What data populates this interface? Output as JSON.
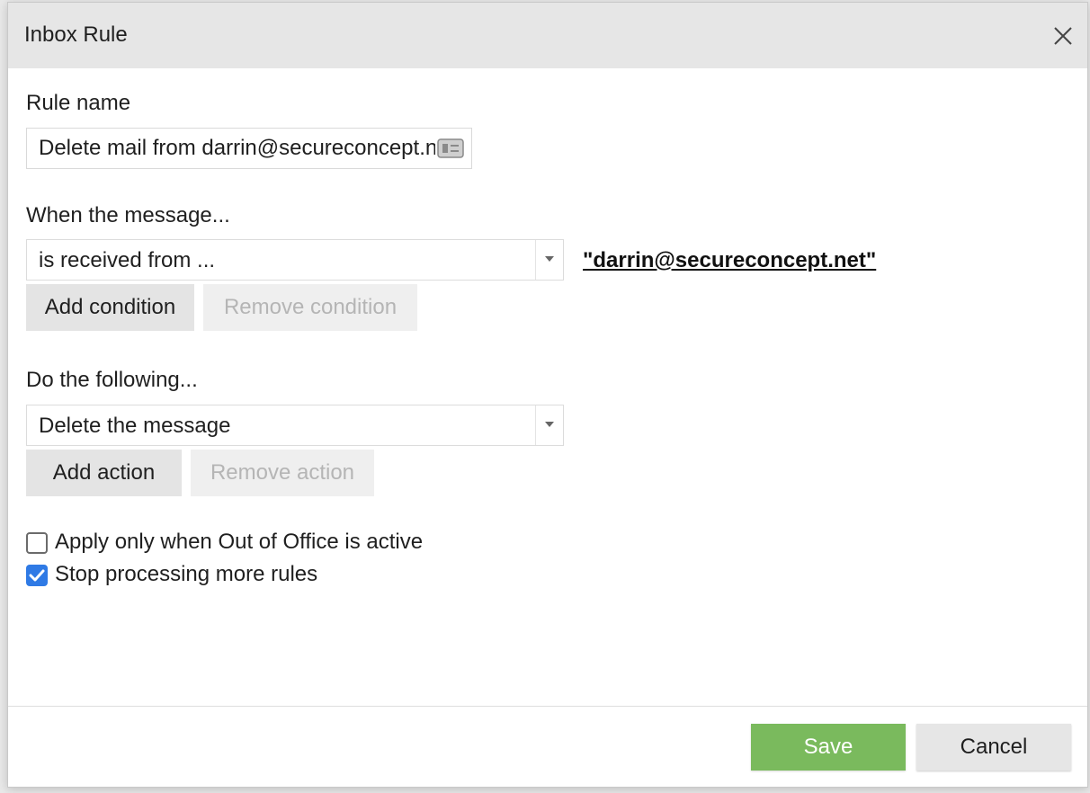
{
  "dialog": {
    "title": "Inbox Rule"
  },
  "rule_name": {
    "label": "Rule name",
    "value": "Delete mail from darrin@secureconcept.net"
  },
  "condition": {
    "label": "When the message...",
    "selected": "is received from ...",
    "value_link": "\"darrin@secureconcept.net\"",
    "add_label": "Add condition",
    "remove_label": "Remove condition"
  },
  "action": {
    "label": "Do the following...",
    "selected": "Delete the message",
    "add_label": "Add action",
    "remove_label": "Remove action"
  },
  "options": {
    "out_of_office": {
      "label": "Apply only when Out of Office is active",
      "checked": false
    },
    "stop_processing": {
      "label": "Stop processing more rules",
      "checked": true
    }
  },
  "footer": {
    "save_label": "Save",
    "cancel_label": "Cancel"
  },
  "colors": {
    "save_button": "#7aba5d",
    "checkbox_checked": "#2f7ae5",
    "titlebar": "#e6e6e6"
  },
  "icons": {
    "close": "close-icon",
    "dropdown": "chevron-down-icon",
    "input_extension": "contact-card-icon",
    "checkmark": "checkmark-icon"
  }
}
